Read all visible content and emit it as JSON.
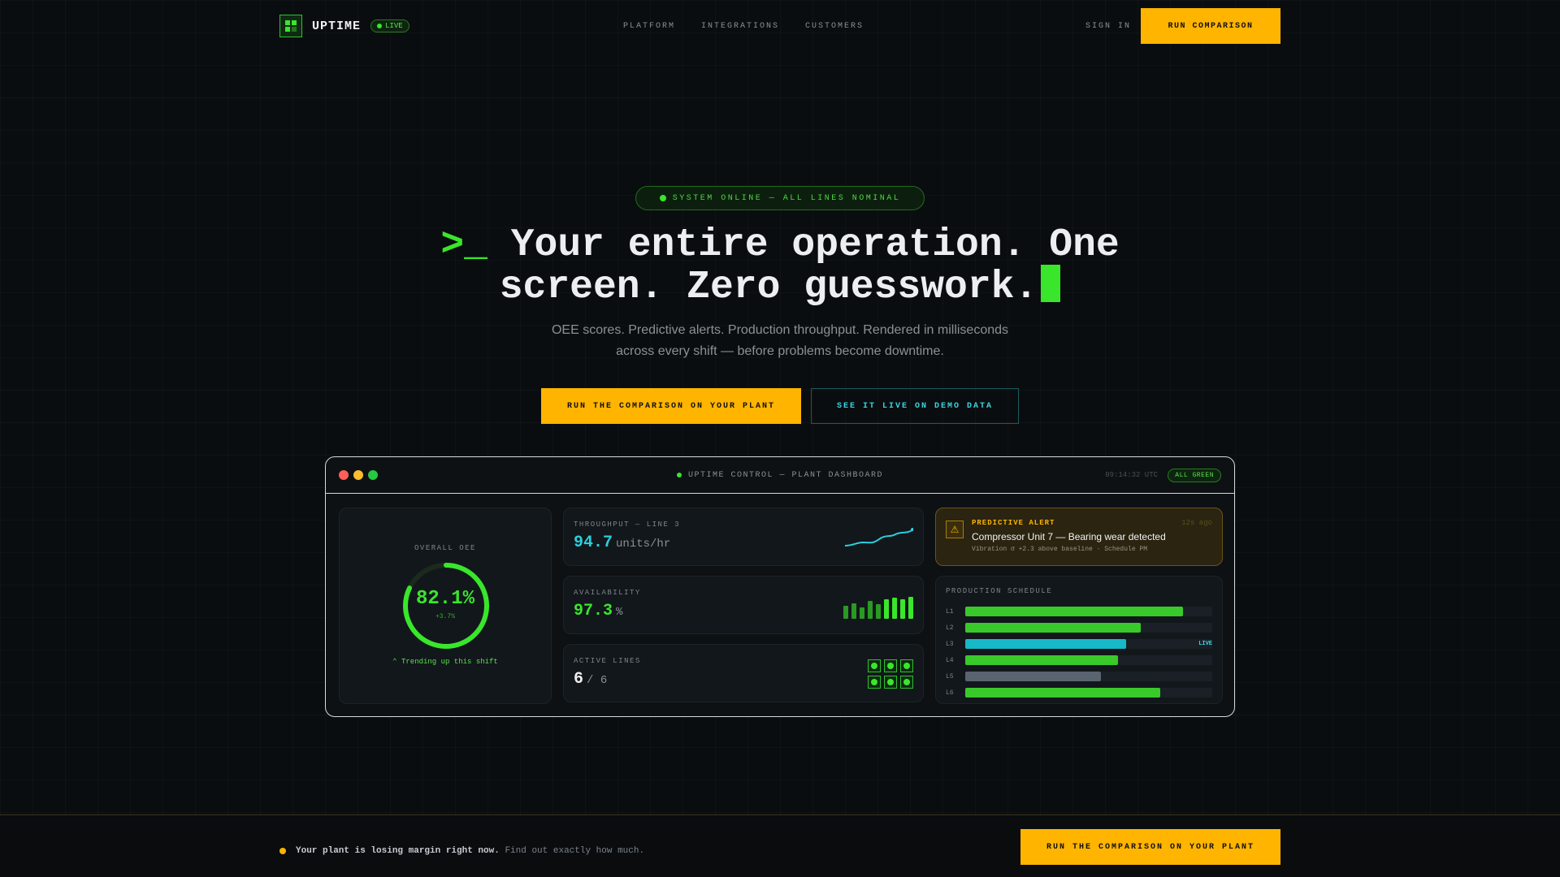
{
  "nav": {
    "brand": "UPTIME",
    "live_label": "LIVE",
    "links": [
      "PLATFORM",
      "INTEGRATIONS",
      "CUSTOMERS"
    ],
    "signin": "SIGN IN",
    "cta": "RUN COMPARISON"
  },
  "hero": {
    "status": "SYSTEM ONLINE — ALL LINES NOMINAL",
    "prompt": ">_",
    "title": "Your entire operation. One screen. Zero guesswork.",
    "subtitle": "OEE scores. Predictive alerts. Production throughput. Rendered in milliseconds across every shift — before problems become downtime.",
    "primary_cta": "RUN THE COMPARISON ON YOUR PLANT",
    "secondary_cta": "SEE IT LIVE ON DEMO DATA"
  },
  "dashboard": {
    "title": "UPTIME CONTROL — PLANT DASHBOARD",
    "time": "09:14:32 UTC",
    "status_badge": "ALL GREEN",
    "oee": {
      "label": "OVERALL OEE",
      "value": "82.1%",
      "fraction": 0.821,
      "delta": "+3.7%",
      "trend": "Trending up this shift"
    },
    "throughput": {
      "label": "THROUGHPUT — LINE 3",
      "value": "94.7",
      "unit": "units/hr"
    },
    "availability": {
      "label": "AVAILABILITY",
      "value": "97.3",
      "unit": "%",
      "bars": [
        0.5,
        0.6,
        0.45,
        0.7,
        0.55,
        0.75,
        0.8,
        0.75,
        0.85
      ]
    },
    "active_lines": {
      "label": "ACTIVE LINES",
      "value": "6",
      "total": "/ 6"
    },
    "alert": {
      "label": "PREDICTIVE ALERT",
      "time": "12s ago",
      "title": "Compressor Unit 7 — Bearing wear detected",
      "desc": "Vibration σ +2.3 above baseline · Schedule PM"
    },
    "schedule": {
      "label": "PRODUCTION SCHEDULE",
      "rows": [
        {
          "line": "L1",
          "progress": 0.88,
          "color": "#39c92a",
          "tag": ""
        },
        {
          "line": "L2",
          "progress": 0.71,
          "color": "#39c92a",
          "tag": ""
        },
        {
          "line": "L3",
          "progress": 0.65,
          "color": "#17b8c8",
          "tag": "LIVE"
        },
        {
          "line": "L4",
          "progress": 0.62,
          "color": "#39c92a",
          "tag": ""
        },
        {
          "line": "L5",
          "progress": 0.55,
          "color": "#5a6470",
          "tag": ""
        },
        {
          "line": "L6",
          "progress": 0.79,
          "color": "#39c92a",
          "tag": ""
        }
      ]
    },
    "colors": {
      "green": "#39e62b",
      "cyan": "#2ad0dc",
      "yellow": "#ffb400"
    }
  },
  "footer": {
    "bold": "Your plant is losing margin right now.",
    "text": "Find out exactly how much.",
    "cta": "RUN THE COMPARISON ON YOUR PLANT"
  }
}
